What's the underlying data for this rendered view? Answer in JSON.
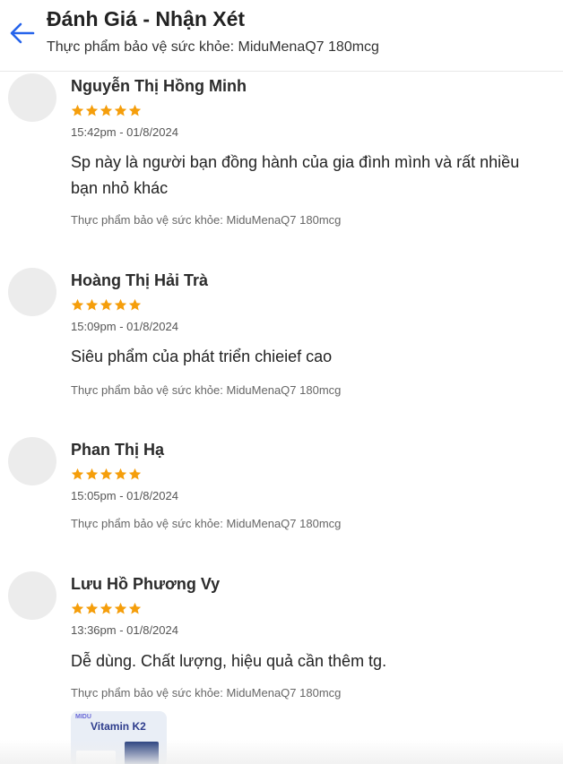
{
  "header": {
    "title": "Đánh Giá - Nhận Xét",
    "subtitle": "Thực phẩm bảo vệ sức khỏe: MiduMenaQ7 180mcg",
    "back_icon": "arrow-left-icon"
  },
  "colors": {
    "accent": "#2563eb",
    "star": "#f59e0b"
  },
  "reviews": [
    {
      "name": "Nguyễn Thị Hồng Minh",
      "rating": 5,
      "time": "15:42pm - 01/8/2024",
      "comment": "Sp này là người bạn đồng hành của gia đình mình và rất nhiều bạn nhỏ khác",
      "product": "Thực phẩm bảo vệ sức khỏe: MiduMenaQ7 180mcg"
    },
    {
      "name": "Hoàng Thị Hải Trà",
      "rating": 5,
      "time": "15:09pm - 01/8/2024",
      "comment": "Siêu phẩm của phát triển chieief cao",
      "product": "Thực phẩm bảo vệ sức khỏe: MiduMenaQ7 180mcg"
    },
    {
      "name": "Phan Thị Hạ",
      "rating": 5,
      "time": "15:05pm - 01/8/2024",
      "comment": "",
      "product": "Thực phẩm bảo vệ sức khỏe: MiduMenaQ7 180mcg"
    },
    {
      "name": "Lưu Hồ Phương Vy",
      "rating": 5,
      "time": "13:36pm - 01/8/2024",
      "comment": "Dễ dùng. Chất lượng, hiệu quả cần thêm tg.",
      "product": "Thực phẩm bảo vệ sức khỏe: MiduMenaQ7 180mcg",
      "image": {
        "brand": "MIDU",
        "title": "Vitamin K2"
      }
    }
  ]
}
